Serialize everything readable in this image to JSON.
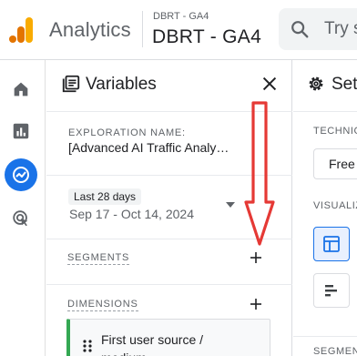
{
  "header": {
    "app_title": "Analytics",
    "account_small": "DBRT - GA4",
    "account_big": "DBRT - GA4",
    "search_placeholder": "Try s"
  },
  "nav": {
    "items": [
      {
        "icon": "home-icon"
      },
      {
        "icon": "reports-icon"
      },
      {
        "icon": "explore-icon",
        "active": true
      },
      {
        "icon": "advertising-icon"
      }
    ],
    "active_color": "#1a73e8"
  },
  "variables_panel": {
    "title": "Variables",
    "exploration_label": "EXPLORATION NAME:",
    "exploration_value": "[Advanced AI Traffic Analy…",
    "date_preset": "Last 28 days",
    "date_range": "Sep 17 - Oct 14, 2024",
    "segments_label": "SEGMENTS",
    "dimensions_label": "DIMENSIONS",
    "dimension_items": [
      {
        "label_line1": "First user source /",
        "label_line2": "medium",
        "accent": "#34a853"
      }
    ]
  },
  "settings_panel": {
    "title": "Set",
    "technique_label": "TECHNIC",
    "technique_value": "Free",
    "visualization_label": "VISUALIZ",
    "segment_label": "SEGMEN"
  },
  "annotation": {
    "arrow_color": "#e53935"
  }
}
